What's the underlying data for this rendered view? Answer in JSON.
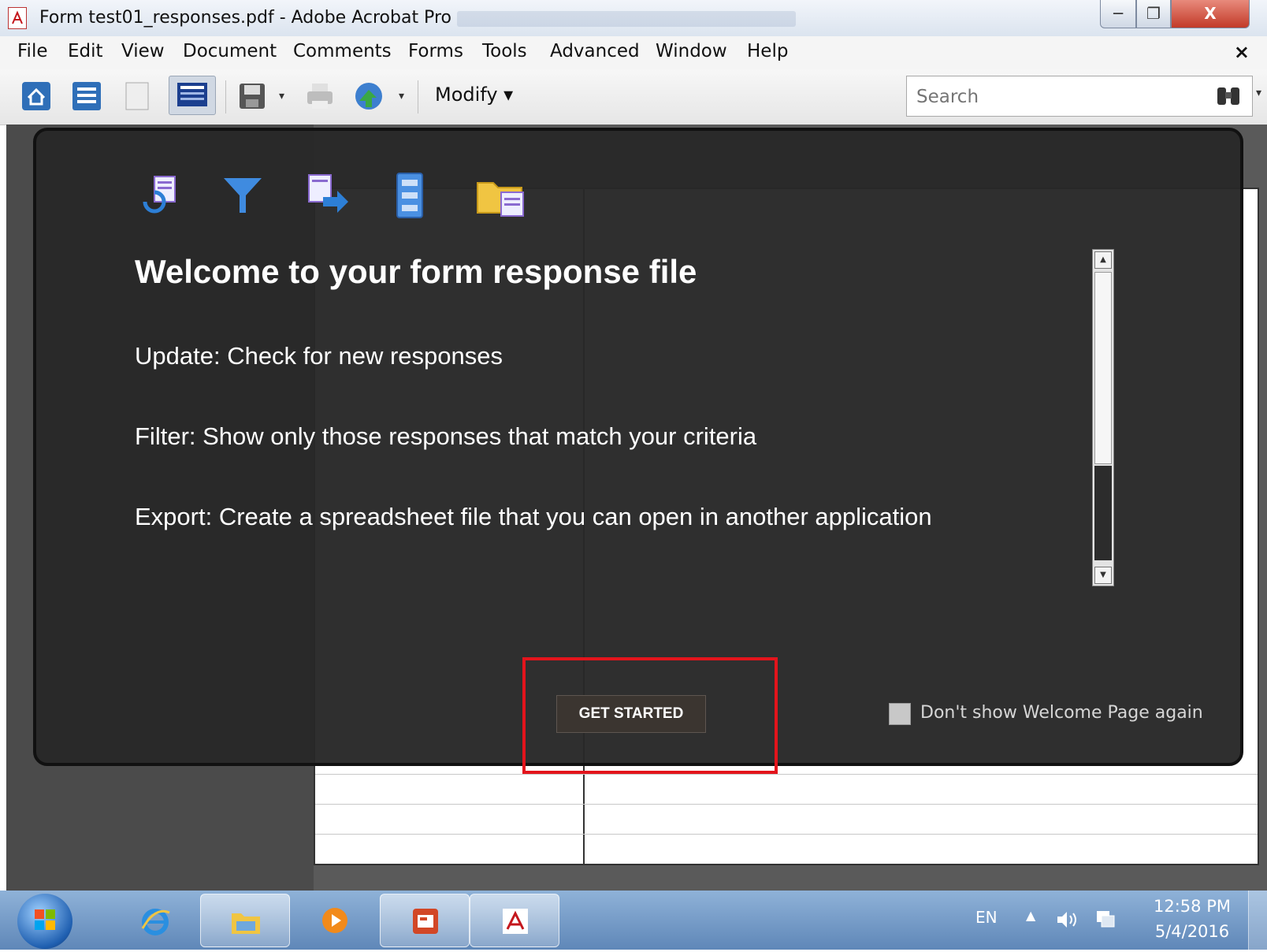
{
  "window": {
    "title": "Form test01_responses.pdf - Adobe Acrobat Pro",
    "min_glyph": "─",
    "max_glyph": "❐",
    "close_glyph": "X"
  },
  "menu": {
    "items": [
      "File",
      "Edit",
      "View",
      "Document",
      "Comments",
      "Forms",
      "Tools",
      "Advanced",
      "Window",
      "Help"
    ],
    "doc_close": "×"
  },
  "toolbar": {
    "modify_label": "Modify ▾",
    "icons": [
      "home-icon",
      "list-view-icon",
      "page-view-icon",
      "form-layout-icon",
      "save-icon",
      "print-icon",
      "globe-share-icon"
    ],
    "search_placeholder": "Search"
  },
  "welcome": {
    "title": "Welcome to your form response file",
    "lines": [
      "Update: Check for new responses",
      "Filter: Show only those responses that match your criteria",
      "Export: Create a spreadsheet file that you can open in another application"
    ],
    "feature_icons": [
      "update-icon",
      "filter-icon",
      "export-icon",
      "archive-icon",
      "folder-icon"
    ],
    "button_label": "GET STARTED",
    "checkbox_label": "Don't show Welcome Page again",
    "checkbox_checked": false
  },
  "taskbar": {
    "apps": [
      "internet-explorer-icon",
      "file-explorer-icon",
      "media-player-icon",
      "powerpoint-icon",
      "acrobat-icon"
    ],
    "language": "EN",
    "tray_caret": "▲",
    "time": "12:58 PM",
    "date": "5/4/2016"
  },
  "colors": {
    "overlay_bg": "#282828",
    "highlight": "#e3141c",
    "taskbar": "#6f95c4"
  }
}
